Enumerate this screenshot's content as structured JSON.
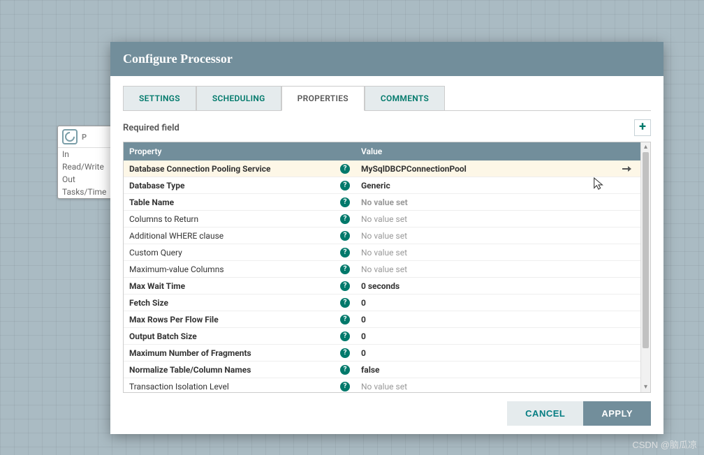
{
  "dialog": {
    "title": "Configure Processor",
    "tabs": [
      {
        "label": "SETTINGS",
        "active": false
      },
      {
        "label": "SCHEDULING",
        "active": false
      },
      {
        "label": "PROPERTIES",
        "active": true
      },
      {
        "label": "COMMENTS",
        "active": false
      }
    ],
    "required_label": "Required field",
    "add_button_title": "Add Property",
    "table": {
      "headers": {
        "property": "Property",
        "value": "Value"
      },
      "rows": [
        {
          "name": "Database Connection Pooling Service",
          "value": "MySqlDBCPConnectionPool",
          "bold": true,
          "placeholder": false,
          "hover": true,
          "goto": true
        },
        {
          "name": "Database Type",
          "value": "Generic",
          "bold": true,
          "placeholder": false
        },
        {
          "name": "Table Name",
          "value": "No value set",
          "bold": true,
          "placeholder": true
        },
        {
          "name": "Columns to Return",
          "value": "No value set",
          "bold": false,
          "placeholder": true
        },
        {
          "name": "Additional WHERE clause",
          "value": "No value set",
          "bold": false,
          "placeholder": true
        },
        {
          "name": "Custom Query",
          "value": "No value set",
          "bold": false,
          "placeholder": true
        },
        {
          "name": "Maximum-value Columns",
          "value": "No value set",
          "bold": false,
          "placeholder": true
        },
        {
          "name": "Max Wait Time",
          "value": "0 seconds",
          "bold": true,
          "placeholder": false
        },
        {
          "name": "Fetch Size",
          "value": "0",
          "bold": true,
          "placeholder": false
        },
        {
          "name": "Max Rows Per Flow File",
          "value": "0",
          "bold": true,
          "placeholder": false
        },
        {
          "name": "Output Batch Size",
          "value": "0",
          "bold": true,
          "placeholder": false
        },
        {
          "name": "Maximum Number of Fragments",
          "value": "0",
          "bold": true,
          "placeholder": false
        },
        {
          "name": "Normalize Table/Column Names",
          "value": "false",
          "bold": true,
          "placeholder": false
        },
        {
          "name": "Transaction Isolation Level",
          "value": "No value set",
          "bold": false,
          "placeholder": true
        }
      ]
    },
    "buttons": {
      "cancel": "CANCEL",
      "apply": "APPLY"
    }
  },
  "processor_card": {
    "p": "P",
    "rows": [
      "In",
      "Read/Write",
      "Out",
      "Tasks/Time"
    ]
  },
  "watermark": "CSDN @脑瓜凉",
  "colors": {
    "header": "#728e9b",
    "accent": "#00796b"
  }
}
